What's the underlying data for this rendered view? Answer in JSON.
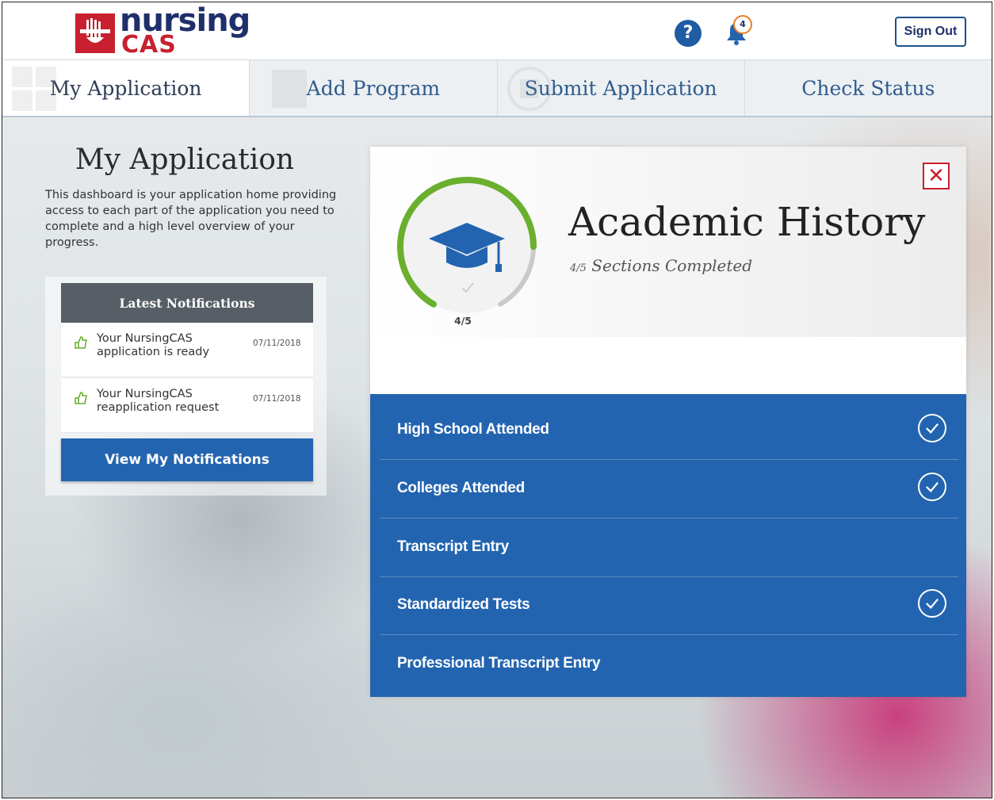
{
  "brand": {
    "name_top": "nursing",
    "name_bottom": "CAS"
  },
  "header": {
    "help_icon": "question-mark",
    "bell_icon": "notification-bell",
    "notification_count": "4",
    "sign_out_label": "Sign Out"
  },
  "nav": {
    "tabs": [
      {
        "label": "My Application",
        "active": true
      },
      {
        "label": "Add Program",
        "active": false
      },
      {
        "label": "Submit Application",
        "active": false
      },
      {
        "label": "Check Status",
        "active": false
      }
    ]
  },
  "main": {
    "title": "My Application",
    "description": "This dashboard is your application home providing access to each part of the application you need to complete and a high level overview of your progress."
  },
  "notifications": {
    "heading": "Latest Notifications",
    "items": [
      {
        "text": "Your NursingCAS application is ready",
        "date": "07/11/2018"
      },
      {
        "text": "Your NursingCAS reapplication request",
        "date": "07/11/2018"
      }
    ],
    "button_label": "View My Notifications"
  },
  "panel": {
    "title": "Academic History",
    "progress_fraction": "4/5",
    "progress_text": "Sections Completed",
    "ring_label": "4/5",
    "progress_value": 0.8,
    "ring_color": "#6aaf2e",
    "accent_color": "#2364b0",
    "close_icon": "close-x",
    "sections": [
      {
        "label": "High School Attended",
        "completed": true
      },
      {
        "label": "Colleges Attended",
        "completed": true
      },
      {
        "label": "Transcript Entry",
        "completed": false
      },
      {
        "label": "Standardized Tests",
        "completed": true
      },
      {
        "label": "Professional Transcript Entry",
        "completed": false
      }
    ]
  }
}
